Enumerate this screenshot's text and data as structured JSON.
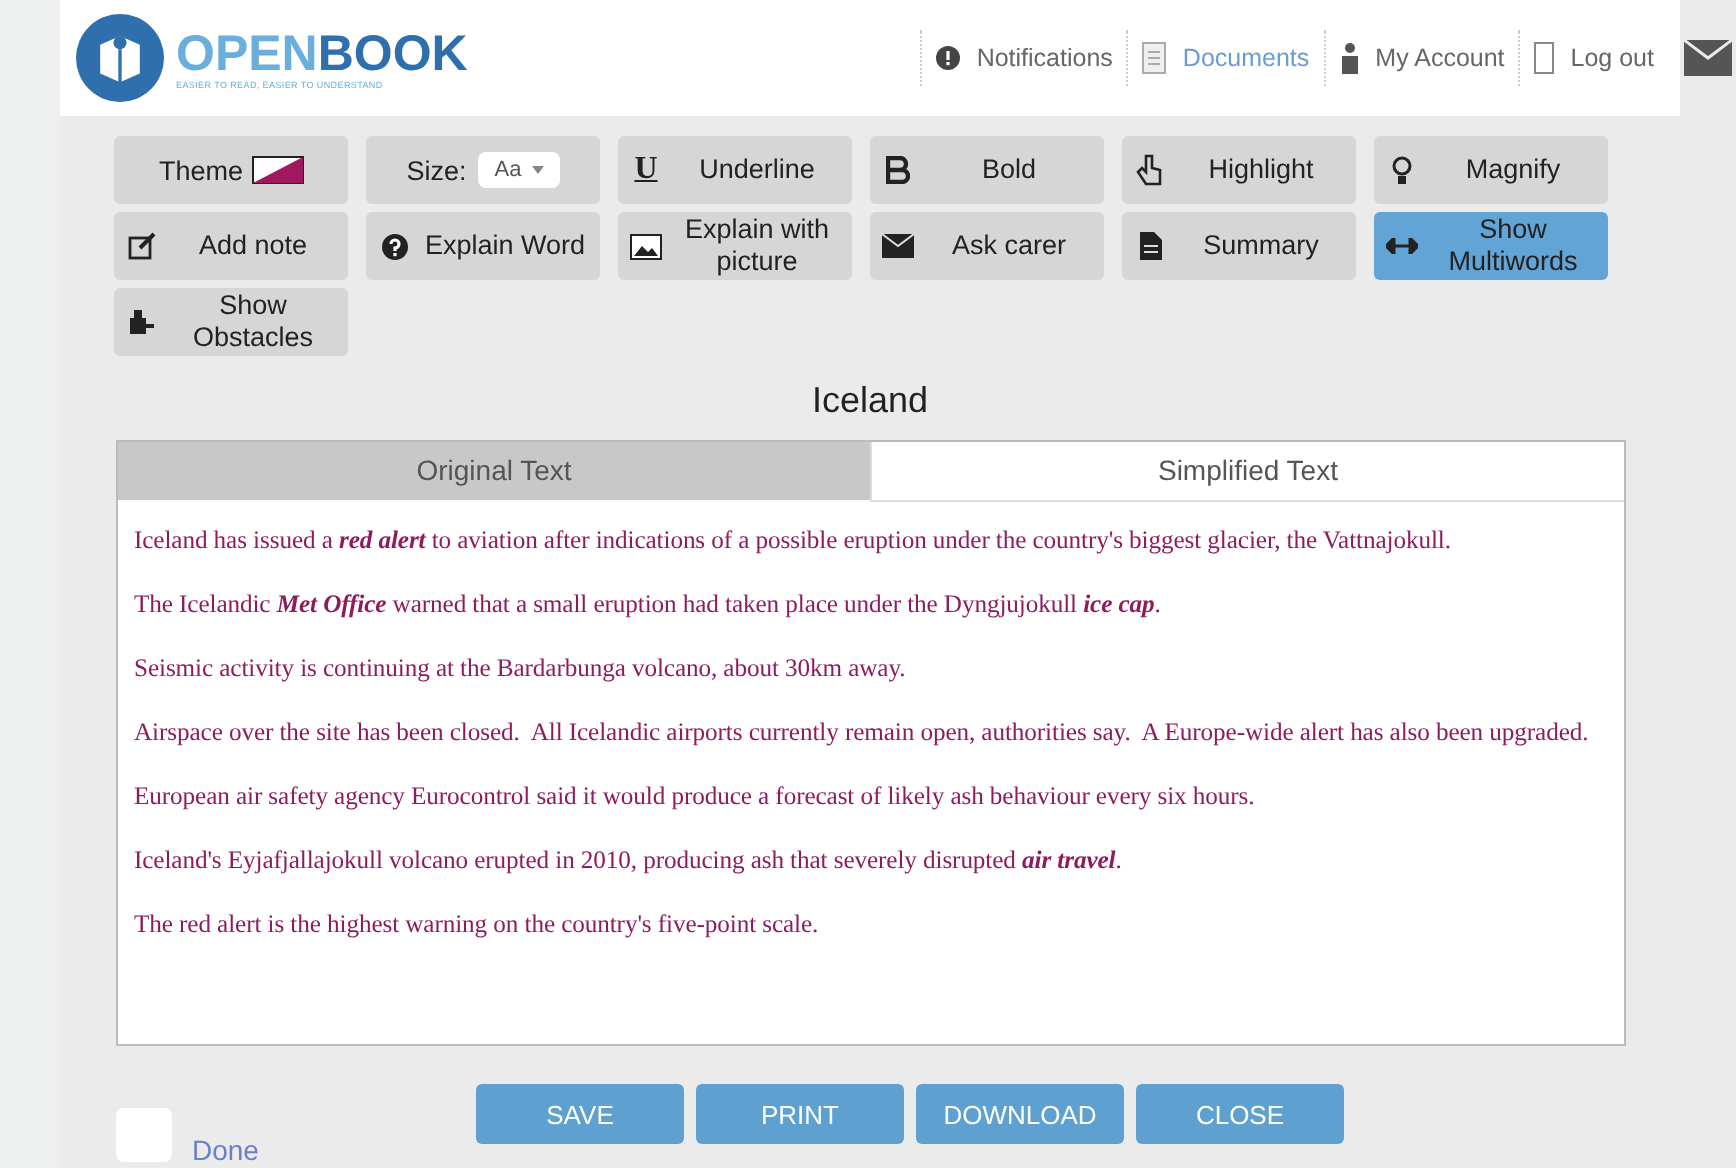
{
  "header": {
    "logo": {
      "name_a": "OPEN",
      "name_b": "BOOK",
      "tagline": "EASIER TO READ, EASIER TO UNDERSTAND"
    },
    "nav": [
      {
        "label": "Notifications",
        "selected": false
      },
      {
        "label": "Documents",
        "selected": true
      },
      {
        "label": "My Account",
        "selected": false
      },
      {
        "label": "Log out",
        "selected": false
      }
    ]
  },
  "toolbar": [
    {
      "kind": "theme",
      "label": "Theme",
      "active": false
    },
    {
      "kind": "size",
      "label": "Size:",
      "value": "Aa",
      "active": false
    },
    {
      "kind": "tool",
      "label": "Underline",
      "icon_text": "U",
      "active": false
    },
    {
      "kind": "tool",
      "label": "Bold",
      "active": false
    },
    {
      "kind": "tool",
      "label": "Highlight",
      "active": false
    },
    {
      "kind": "tool",
      "label": "Magnify",
      "active": false
    },
    {
      "kind": "tool",
      "label": "Add note",
      "active": false
    },
    {
      "kind": "tool",
      "label": "Explain Word",
      "active": false
    },
    {
      "kind": "tool",
      "label": "Explain with picture",
      "active": false
    },
    {
      "kind": "tool",
      "label": "Ask carer",
      "active": false
    },
    {
      "kind": "tool",
      "label": "Summary",
      "active": false
    },
    {
      "kind": "tool",
      "label": "Show Multiwords",
      "active": true
    },
    {
      "kind": "tool",
      "label": "Show Obstacles",
      "active": false
    }
  ],
  "document": {
    "title": "Iceland",
    "tabs": [
      {
        "label": "Original Text",
        "selected": false
      },
      {
        "label": "Simplified Text",
        "selected": true
      }
    ],
    "paragraphs": [
      "Iceland has issued a **red alert** to aviation after indications of a possible eruption under the country's biggest glacier, the Vattnajokull.",
      "The Icelandic **Met Office** warned that a small eruption had taken place under the Dyngjujokull **ice cap**.",
      "Seismic activity is continuing at the Bardarbunga volcano, about 30km away.",
      "Airspace over the site has been closed.  All Icelandic airports currently remain open, authorities say.  A Europe-wide alert has also been upgraded.",
      "European air safety agency Eurocontrol said it would produce a forecast of likely ash behaviour every six hours.",
      "Iceland's Eyjafjallajokull volcano erupted in 2010, producing ash that severely disrupted **air travel**.",
      "The red alert is the highest warning on the country's five-point scale."
    ]
  },
  "footer": {
    "done": {
      "label": "Done",
      "checked": false
    },
    "buttons": [
      "SAVE",
      "PRINT",
      "DOWNLOAD",
      "CLOSE"
    ]
  }
}
